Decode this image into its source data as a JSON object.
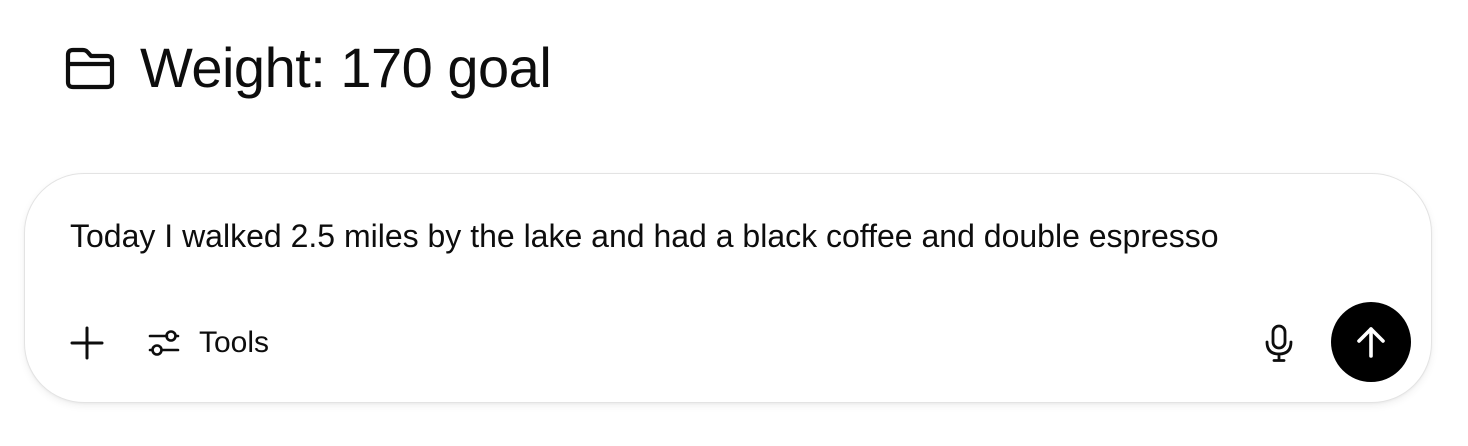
{
  "header": {
    "icon": "folder-icon",
    "title": "Weight: 170 goal"
  },
  "composer": {
    "input_value": "Today I walked 2.5 miles by the lake and had a black coffee and double espresso",
    "plus_icon": "plus-icon",
    "tools_icon": "sliders-icon",
    "tools_label": "Tools",
    "mic_icon": "microphone-icon",
    "send_icon": "arrow-up-icon"
  },
  "colors": {
    "text": "#0d0d0d",
    "border": "#e3e3e3",
    "send_button_bg": "#000000",
    "send_button_fg": "#ffffff"
  }
}
